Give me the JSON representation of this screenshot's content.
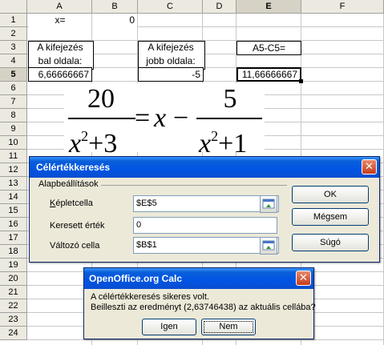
{
  "sheet": {
    "columns": [
      "A",
      "B",
      "C",
      "D",
      "E",
      "F"
    ],
    "rows": [
      "1",
      "2",
      "3",
      "4",
      "5",
      "6",
      "7",
      "8",
      "9",
      "10",
      "11",
      "12",
      "13",
      "14",
      "15",
      "16",
      "17",
      "18",
      "19",
      "20",
      "21",
      "22",
      "23",
      "24"
    ],
    "selected_row": "5",
    "selected_col": "E",
    "cells": {
      "A1": "x=",
      "B1": "0",
      "A3": "A kifejezés",
      "A4": "bal oldala:",
      "A5": "6,66666667",
      "C3": "A kifejezés",
      "C4": "jobb oldala:",
      "C5": "-5",
      "E3": "A5-C5=",
      "E5": "11,66666667"
    }
  },
  "formula": {
    "left_num": "20",
    "left_den_x": "x",
    "left_den_exp": "2",
    "left_den_rest": "+3",
    "equals": "=",
    "mid": "x",
    "minus": "−",
    "right_num": "5",
    "right_den_x": "x",
    "right_den_exp": "2",
    "right_den_rest": "+1"
  },
  "goal_dialog": {
    "title": "Célértékkeresés",
    "group_label": "Alapbeállítások",
    "formula_cell_label": "Képletcella",
    "formula_cell_value": "$E$5",
    "target_value_label": "Keresett érték",
    "target_value": "0",
    "variable_cell_label": "Változó cella",
    "variable_cell_value": "$B$1",
    "ok_label": "OK",
    "cancel_label": "Mégsem",
    "help_label": "Súgó",
    "close_label": "✕"
  },
  "msg_dialog": {
    "title": "OpenOffice.org Calc",
    "line1": "A célértékkeresés sikeres volt.",
    "line2": "Beilleszti az eredményt (2,63746438) az aktuális cellába?",
    "yes_label": "Igen",
    "no_label": "Nem",
    "close_label": "✕"
  }
}
